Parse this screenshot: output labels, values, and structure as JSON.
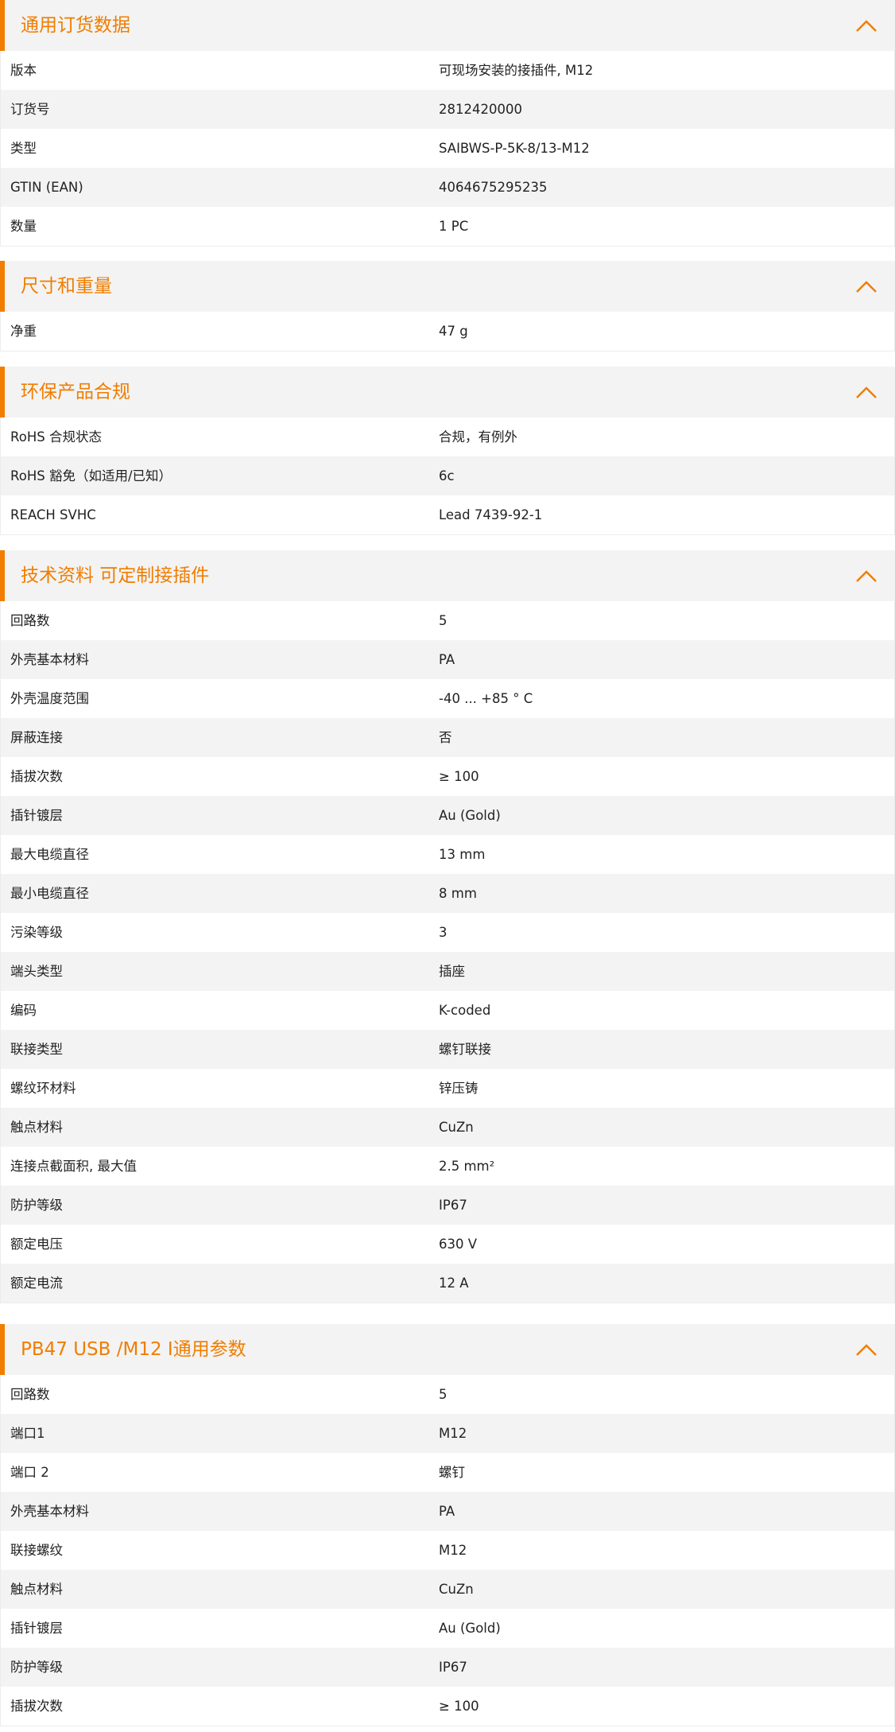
{
  "accent_color": "#f07d00",
  "chevron_icon": "chevron-up-icon",
  "sections": [
    {
      "title": "通用订货数据",
      "rows": [
        {
          "label": "版本",
          "value": "可现场安装的接插件, M12"
        },
        {
          "label": "订货号",
          "value": "2812420000"
        },
        {
          "label": "类型",
          "value": "SAIBWS-P-5K-8/13-M12"
        },
        {
          "label": "GTIN (EAN)",
          "value": "4064675295235"
        },
        {
          "label": "数量",
          "value": "1  PC"
        }
      ]
    },
    {
      "title": "尺寸和重量",
      "rows": [
        {
          "label": "净重",
          "value": "47  g"
        }
      ]
    },
    {
      "title": "环保产品合规",
      "rows": [
        {
          "label": "RoHS 合规状态",
          "value": "合规，有例外"
        },
        {
          "label": "RoHS 豁免（如适用/已知）",
          "value": "6c"
        },
        {
          "label": "REACH SVHC",
          "value": "Lead 7439-92-1"
        }
      ]
    },
    {
      "title": "技术资料 可定制接插件",
      "rows": [
        {
          "label": "回路数",
          "value": "5"
        },
        {
          "label": "外壳基本材料",
          "value": "PA"
        },
        {
          "label": "外壳温度范围",
          "value": "-40 ... +85 ° C"
        },
        {
          "label": "屏蔽连接",
          "value": "否"
        },
        {
          "label": "插拔次数",
          "value": "≥ 100"
        },
        {
          "label": "插针镀层",
          "value": "Au (Gold)"
        },
        {
          "label": "最大电缆直径",
          "value": "13  mm"
        },
        {
          "label": "最小电缆直径",
          "value": "8  mm"
        },
        {
          "label": "污染等级",
          "value": "3"
        },
        {
          "label": "端头类型",
          "value": "插座"
        },
        {
          "label": "编码",
          "value": "K-coded"
        },
        {
          "label": "联接类型",
          "value": "螺钉联接"
        },
        {
          "label": "螺纹环材料",
          "value": "锌压铸"
        },
        {
          "label": "触点材料",
          "value": "CuZn"
        },
        {
          "label": "连接点截面积, 最大值",
          "value": "2.5  mm²"
        },
        {
          "label": "防护等级",
          "value": "IP67"
        },
        {
          "label": "额定电压",
          "value": "630  V"
        },
        {
          "label": "额定电流",
          "value": "12  A"
        }
      ]
    },
    {
      "title": "PB47 USB /M12 I通用参数",
      "rows": [
        {
          "label": "回路数",
          "value": "5"
        },
        {
          "label": "端口1",
          "value": "M12"
        },
        {
          "label": "端口 2",
          "value": "螺钉"
        },
        {
          "label": "外壳基本材料",
          "value": "PA"
        },
        {
          "label": "联接螺纹",
          "value": "M12"
        },
        {
          "label": "触点材料",
          "value": "CuZn"
        },
        {
          "label": "插针镀层",
          "value": "Au (Gold)"
        },
        {
          "label": "防护等级",
          "value": "IP67"
        },
        {
          "label": "插拔次数",
          "value": "≥ 100"
        }
      ]
    }
  ]
}
